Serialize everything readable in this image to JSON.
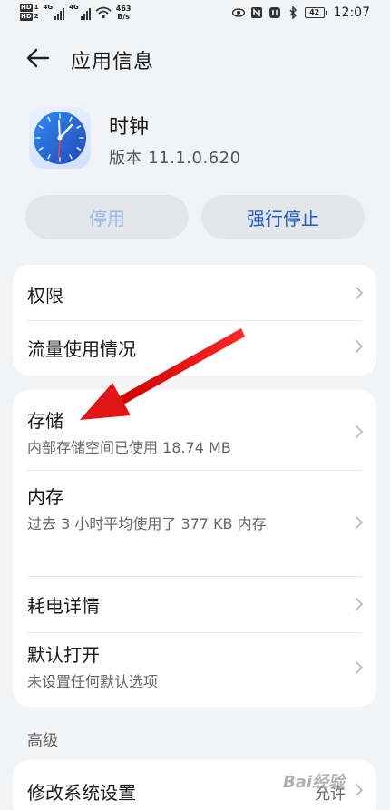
{
  "status_bar": {
    "hd1": "HD",
    "hd1_num": "1",
    "hd2": "HD",
    "hd2_num": "2",
    "sig1_label": "4G",
    "sig2_label": "4G",
    "net_speed_value": "463",
    "net_speed_unit": "B/s",
    "battery": "42",
    "time": "12:07"
  },
  "header": {
    "title": "应用信息"
  },
  "app": {
    "name": "时钟",
    "version": "版本 11.1.0.620"
  },
  "buttons": {
    "disable": "停用",
    "force_stop": "强行停止"
  },
  "card1": [
    {
      "title": "权限"
    },
    {
      "title": "流量使用情况"
    }
  ],
  "card2": [
    {
      "title": "存储",
      "sub": "内部存储空间已使用 18.74 MB"
    },
    {
      "title": "内存",
      "sub": "过去 3 小时平均使用了 377 KB 内存"
    },
    {
      "title": "耗电详情"
    },
    {
      "title": "默认打开",
      "sub": "未设置任何默认选项"
    }
  ],
  "advanced": {
    "label": "高级",
    "modify_settings": "修改系统设置",
    "modify_value": "允许"
  },
  "watermark": "Bai经验",
  "colors": {
    "background": "#f1f3f5",
    "accent": "#1c5ccc",
    "annotation_arrow": "#e01515"
  }
}
